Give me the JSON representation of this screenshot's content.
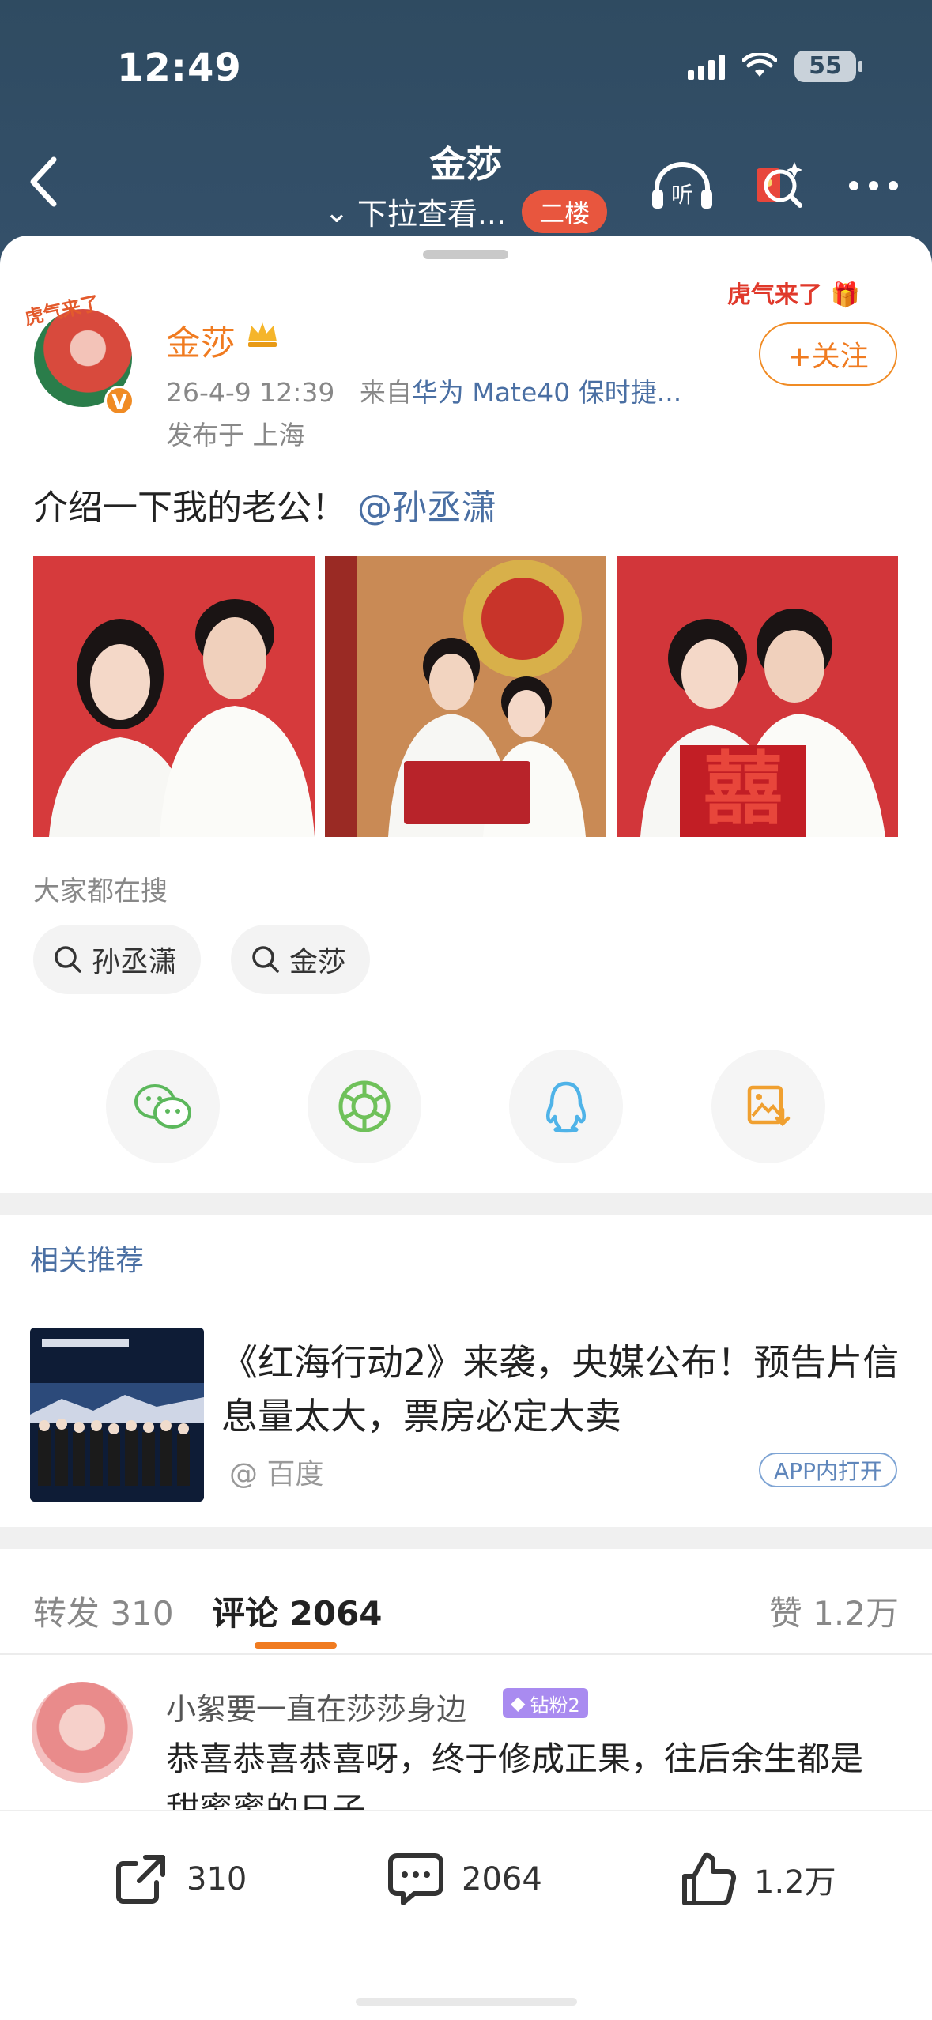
{
  "status_bar": {
    "time": "12:49",
    "battery": "55"
  },
  "header": {
    "title": "金莎",
    "subtitle": "下拉查看...",
    "floor_badge": "二楼"
  },
  "post": {
    "author": "金莎",
    "timestamp": "26-4-9 12:39",
    "source_prefix": "来自",
    "device": "华为 Mate40 保时捷...",
    "location": "发布于 上海",
    "follow_label": "+关注",
    "text": "介绍一下我的老公！",
    "mention": "@孙丞潇"
  },
  "trending": {
    "label": "大家都在搜",
    "chips": [
      "孙丞潇",
      "金莎"
    ]
  },
  "related": {
    "label": "相关推荐",
    "title": "《红海行动2》来袭，央媒公布！预告片信息量太大，票房必定大卖",
    "source": "@ 百度",
    "app_open": "APP内打开"
  },
  "tabs": {
    "repost_label": "转发",
    "repost_count": "310",
    "comment_label": "评论",
    "comment_count": "2064",
    "like_label": "赞",
    "like_count": "1.2万"
  },
  "comment": {
    "user": "小絮要一直在莎莎身边",
    "badge": "钻粉2",
    "text": "恭喜恭喜恭喜呀，终于修成正果，往后余生都是甜蜜蜜的日子"
  },
  "bottom_bar": {
    "repost": "310",
    "comment": "2064",
    "like": "1.2万"
  },
  "colors": {
    "header_bg": "#2f4a60",
    "accent_orange": "#f07b20",
    "link_blue": "#4a6fa3",
    "badge_red": "#e8563e"
  }
}
